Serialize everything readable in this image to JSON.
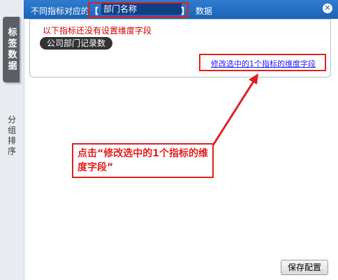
{
  "title": {
    "prefix": "不同指标对应的",
    "bracket_open": "【",
    "field_name": "部门名称",
    "bracket_close": "】",
    "suffix": "数据"
  },
  "side_tabs": [
    {
      "label": "标签数据",
      "active": true
    },
    {
      "label": "分组排序",
      "active": false
    }
  ],
  "panel": {
    "warning": "以下指标还没有设置维度字段",
    "chip_label": "公司部门记录数",
    "modify_link": "修改选中的1个指标的维度字段"
  },
  "callout": {
    "text": "点击“修改选中的1个指标的维度字段”"
  },
  "footer": {
    "save_label": "保存配置"
  },
  "colors": {
    "title_bar": "#1c63b7",
    "annotation_red": "#e02020",
    "warning_red": "#cc0000",
    "link_blue": "#1a1aff"
  }
}
